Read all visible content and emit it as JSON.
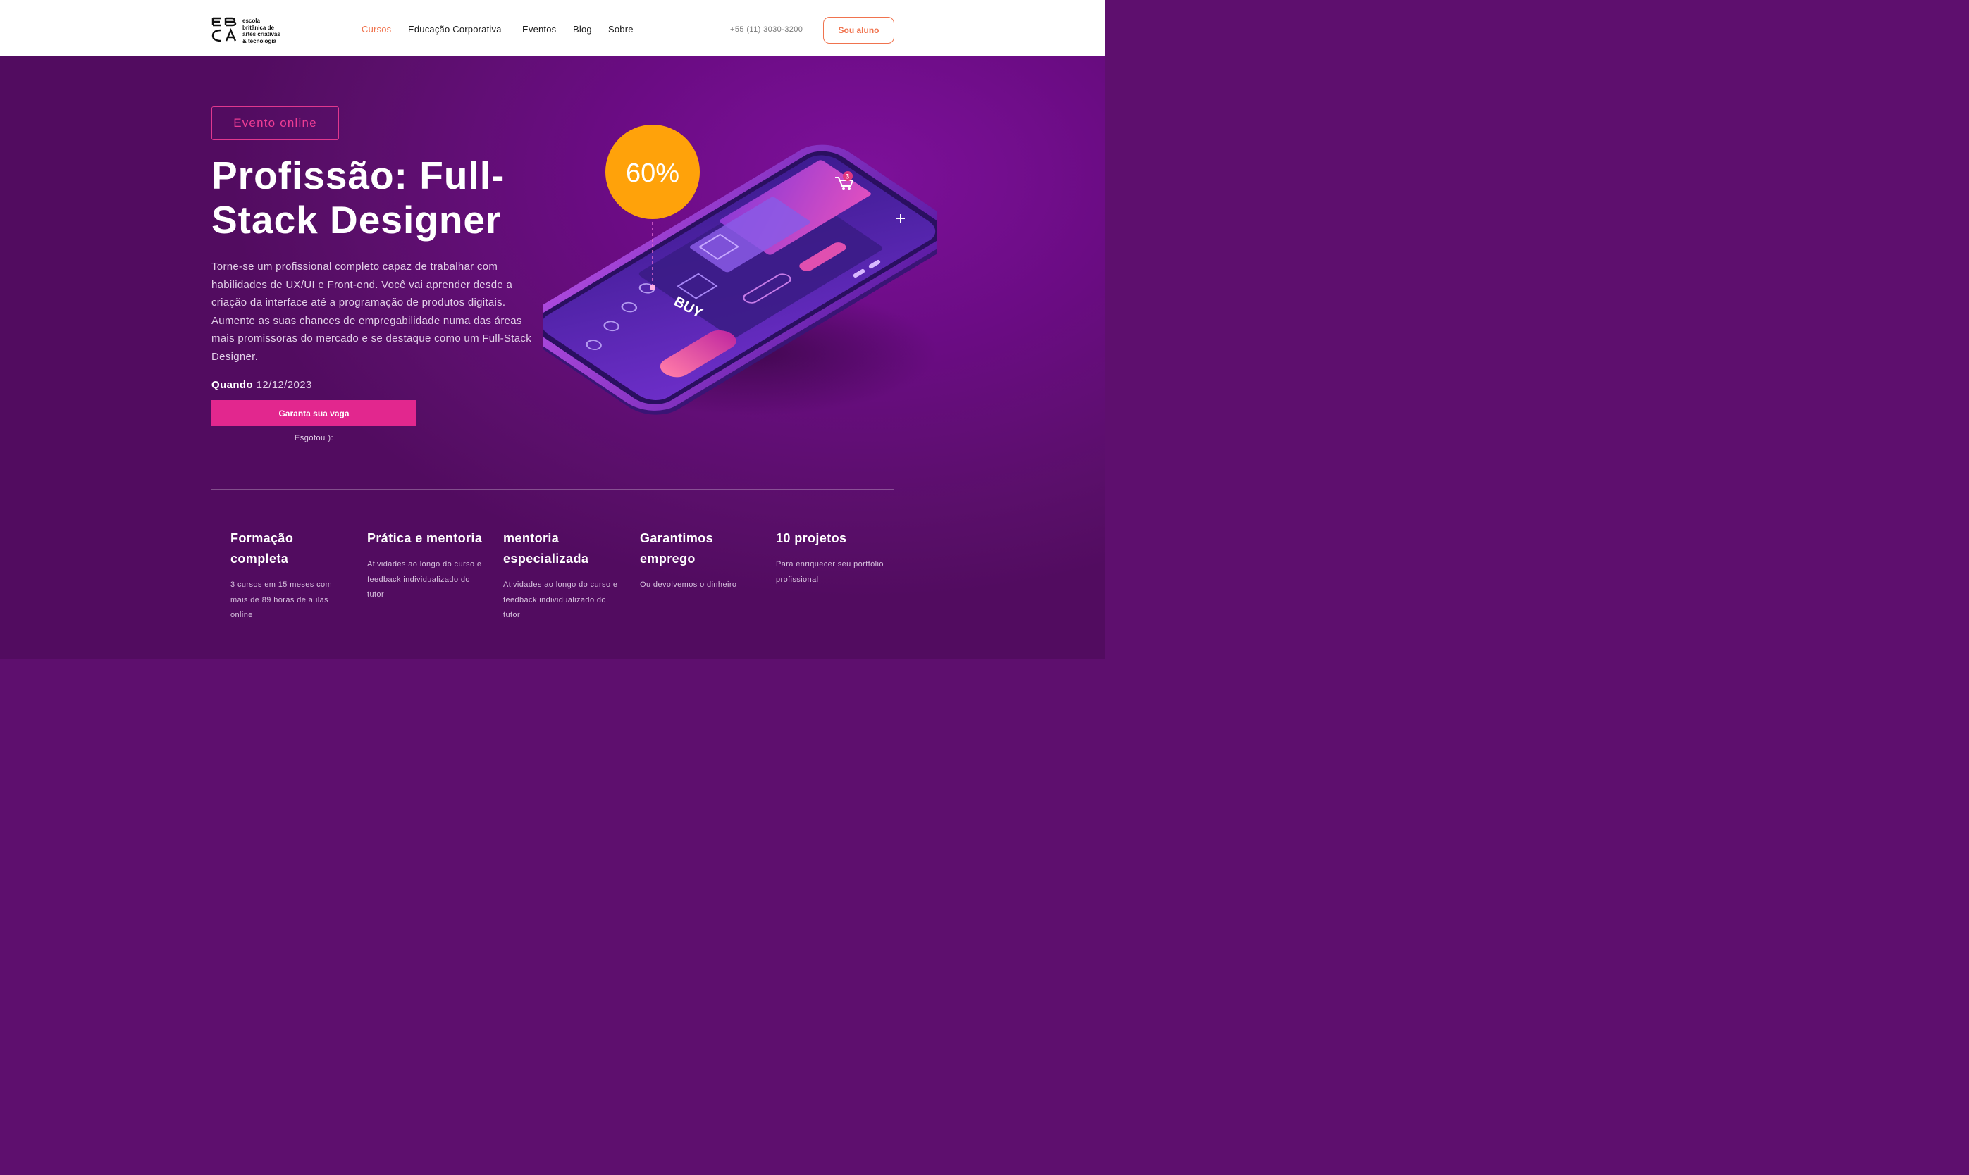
{
  "brand": {
    "logo_lines": [
      "escola",
      "britânica de",
      "artes criativas",
      "& tecnologia"
    ]
  },
  "nav": {
    "items": [
      "Cursos",
      "Educação Corporativa",
      "Eventos",
      "Blog",
      "Sobre"
    ],
    "active": "Cursos"
  },
  "header": {
    "phone": "+55 (11) 3030-3200",
    "student_button": "Sou aluno"
  },
  "colors": {
    "accent_orange": "#f0734e",
    "accent_pink": "#e2278e",
    "hero_purple": "#6b0c84",
    "discount_yellow": "#ffa20a"
  },
  "hero": {
    "badge": "Evento online",
    "title": "Profissão: Full-Stack Designer",
    "description": "Torne-se um profissional completo capaz de trabalhar com habilidades de UX/UI e Front-end. Você vai aprender desde a criação da interface até a programação de produtos digitais. Aumente as suas chances de empregabilidade numa das áreas mais promissoras do mercado e se destaque como um Full-Stack Designer.",
    "when_label": "Quando",
    "when_date": "12/12/2023",
    "cta": "Garanta sua vaga",
    "sold_out": "Esgotou ):"
  },
  "illustration": {
    "discount": "60%",
    "buy_label": "BUY",
    "cart_count": "3"
  },
  "features": [
    {
      "title": "Formação completa",
      "desc": "3 cursos em 15 meses com mais de 89 horas de aulas online"
    },
    {
      "title": "Prática e mentoria",
      "desc": "Atividades ao longo do curso e feedback individualizado do tutor"
    },
    {
      "title": "mentoria especializada",
      "desc": "Atividades ao longo do curso e feedback individualizado do tutor"
    },
    {
      "title": "Garantimos emprego",
      "desc": "Ou devolvemos o dinheiro"
    },
    {
      "title": "10 projetos",
      "desc": "Para enriquecer seu portfólio profissional"
    }
  ]
}
